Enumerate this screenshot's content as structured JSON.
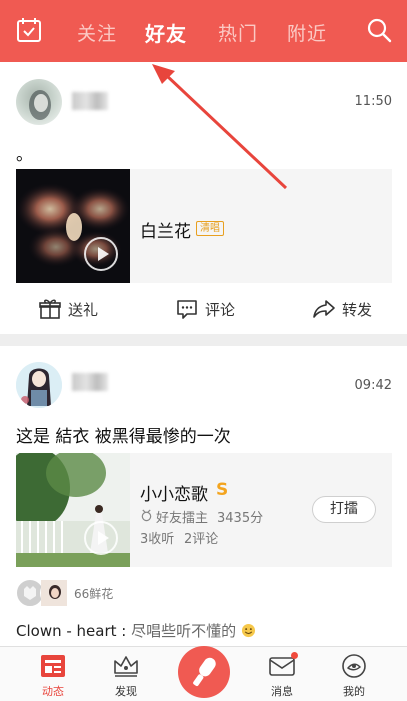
{
  "header": {
    "tabs": [
      {
        "label": "关注",
        "active": false
      },
      {
        "label": "好友",
        "active": true
      },
      {
        "label": "热门",
        "active": false
      },
      {
        "label": "附近",
        "active": false
      }
    ],
    "left_icon": "calendar-check-icon",
    "right_icon": "search-icon"
  },
  "posts": [
    {
      "time": "11:50",
      "caption": "。",
      "song": {
        "title": "白兰花",
        "tag": "清唱"
      },
      "actions": [
        {
          "label": "送礼",
          "icon": "gift-icon"
        },
        {
          "label": "评论",
          "icon": "comment-icon"
        },
        {
          "label": "转发",
          "icon": "share-icon"
        }
      ]
    },
    {
      "time": "09:42",
      "caption": "这是 結衣 被黑得最惨的一次",
      "song": {
        "title": "小小恋歌",
        "badge": "S",
        "host": "好友擂主",
        "score": "3435分",
        "listens": "3收听",
        "comments": "2评论",
        "button": "打擂"
      },
      "flowers": "66鲜花",
      "comment": {
        "user": "Clown - heart",
        "sep": " : ",
        "text": "尽唱些听不懂的"
      }
    }
  ],
  "bottom_nav": [
    {
      "label": "动态",
      "icon": "feed-icon",
      "active": true
    },
    {
      "label": "发现",
      "icon": "crown-icon",
      "active": false
    },
    {
      "label": "",
      "icon": "microphone-icon",
      "active": false
    },
    {
      "label": "消息",
      "icon": "message-icon",
      "active": false,
      "badge": true
    },
    {
      "label": "我的",
      "icon": "profile-icon",
      "active": false
    }
  ],
  "colors": {
    "accent": "#f05a52",
    "tag": "#e8a020",
    "badge_s": "#f3a41e"
  }
}
